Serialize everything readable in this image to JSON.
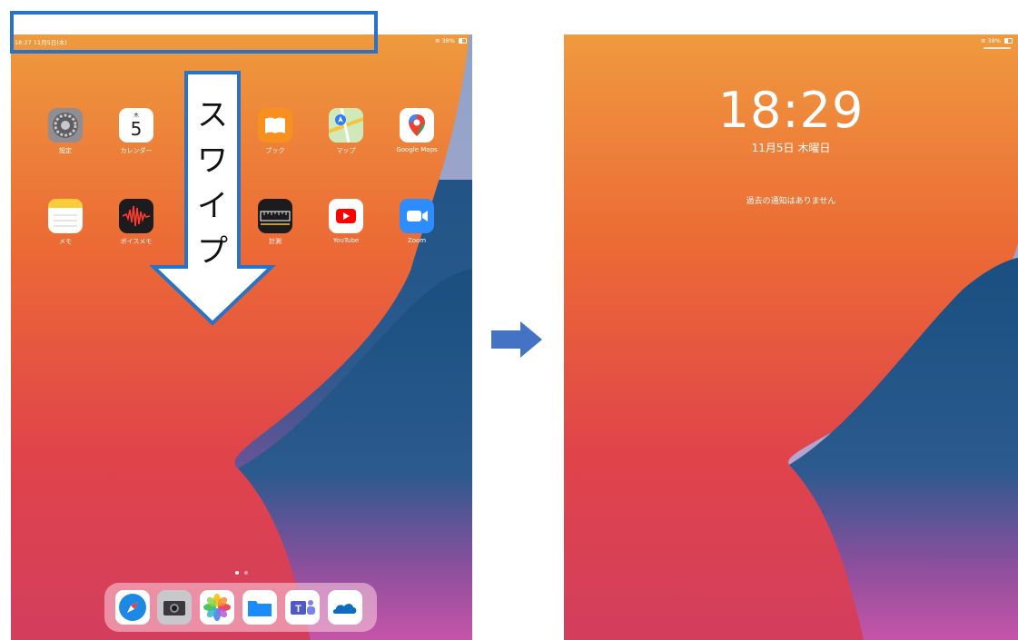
{
  "home": {
    "status": {
      "time_date": "18:27  11月5日(木)",
      "battery": "38%"
    },
    "apps": [
      {
        "label": "設定",
        "icon": "settings-icon"
      },
      {
        "label": "カレンダー",
        "icon": "calendar-icon",
        "weekday": "木",
        "day": "5"
      },
      {
        "label": "ブック",
        "icon": "books-icon"
      },
      {
        "label": "マップ",
        "icon": "maps-icon"
      },
      {
        "label": "Google Maps",
        "icon": "google-maps-icon"
      },
      {
        "label": "メモ",
        "icon": "notes-icon"
      },
      {
        "label": "ボイスメモ",
        "icon": "voice-memos-icon"
      },
      {
        "label": "計測",
        "icon": "measure-icon"
      },
      {
        "label": "YouTube",
        "icon": "youtube-icon"
      },
      {
        "label": "Zoom",
        "icon": "zoom-icon"
      }
    ],
    "dock": [
      "safari-icon",
      "camera-icon",
      "photos-icon",
      "files-icon",
      "teams-icon",
      "onedrive-icon"
    ]
  },
  "annotation": {
    "swipe_text": [
      "ス",
      "ワ",
      "イ",
      "プ"
    ]
  },
  "lock": {
    "status": {
      "battery": "38%"
    },
    "time": "18:29",
    "date": "11月5日 木曜日",
    "notice": "過去の通知はありません"
  },
  "colors": {
    "annotation_blue": "#2673c7",
    "arrow_blue": "#4472c4",
    "wall_orange": "#f08a2c",
    "wall_red": "#e2453f",
    "wall_navy": "#1d4f7c",
    "wall_pink": "#c84fa8"
  }
}
